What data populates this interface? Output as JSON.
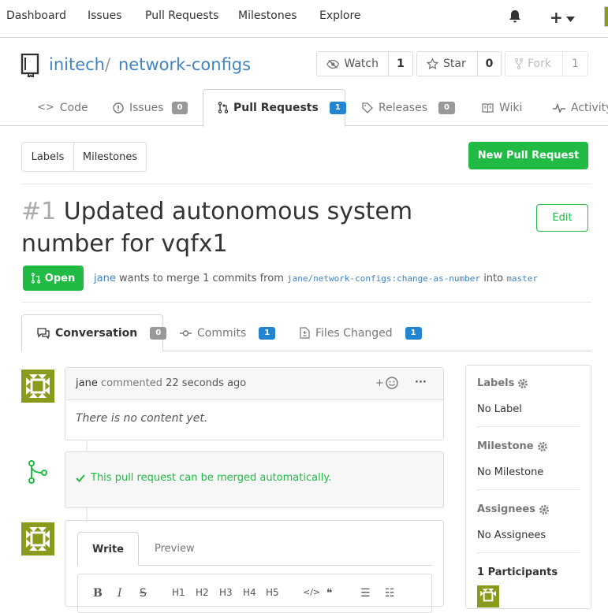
{
  "topnav": {
    "items": [
      "Dashboard",
      "Issues",
      "Pull Requests",
      "Milestones",
      "Explore"
    ]
  },
  "repo": {
    "owner": "initech",
    "separator": "/",
    "name": "network-configs",
    "watch_label": "Watch",
    "watch_count": "1",
    "star_label": "Star",
    "star_count": "0",
    "fork_label": "Fork",
    "fork_count": "1"
  },
  "tabs": [
    {
      "label": "Code",
      "count": ""
    },
    {
      "label": "Issues",
      "count": "0"
    },
    {
      "label": "Pull Requests",
      "count": "1"
    },
    {
      "label": "Releases",
      "count": "0"
    },
    {
      "label": "Wiki",
      "count": ""
    },
    {
      "label": "Activity",
      "count": ""
    }
  ],
  "filters": {
    "labels": "Labels",
    "milestones": "Milestones",
    "new_pr": "New Pull Request"
  },
  "pr": {
    "number": "#1",
    "title_line1": "Updated autonomous system",
    "title_line2": "number for vqfx1",
    "edit": "Edit",
    "status": "Open",
    "author": "jane",
    "merge_text": "wants to merge 1 commits from",
    "source_branch": "jane/network-configs:change-as-number",
    "into": "into",
    "target_branch": "master"
  },
  "pr_tabs": [
    {
      "label": "Conversation",
      "count": "0"
    },
    {
      "label": "Commits",
      "count": "1"
    },
    {
      "label": "Files Changed",
      "count": "1"
    }
  ],
  "comment": {
    "author": "jane",
    "action": "commented",
    "time": "22 seconds ago",
    "body": "There is no content yet.",
    "more": "···",
    "plus": "+"
  },
  "merge": {
    "text": "This pull request can be merged automatically."
  },
  "editor": {
    "write": "Write",
    "preview": "Preview",
    "toolbar": [
      "B",
      "I",
      "S",
      "H1",
      "H2",
      "H3",
      "H4",
      "H5",
      "</>",
      "❝",
      "☰",
      "☷"
    ]
  },
  "sidebar": {
    "labels_title": "Labels",
    "labels_value": "No Label",
    "milestone_title": "Milestone",
    "milestone_value": "No Milestone",
    "assignees_title": "Assignees",
    "assignees_value": "No Assignees",
    "participants_title": "1 Participants"
  },
  "colors": {
    "green": "#21ba45",
    "blue": "#2185d0",
    "link": "#4183c4",
    "avatar": "#8a9a1a"
  }
}
